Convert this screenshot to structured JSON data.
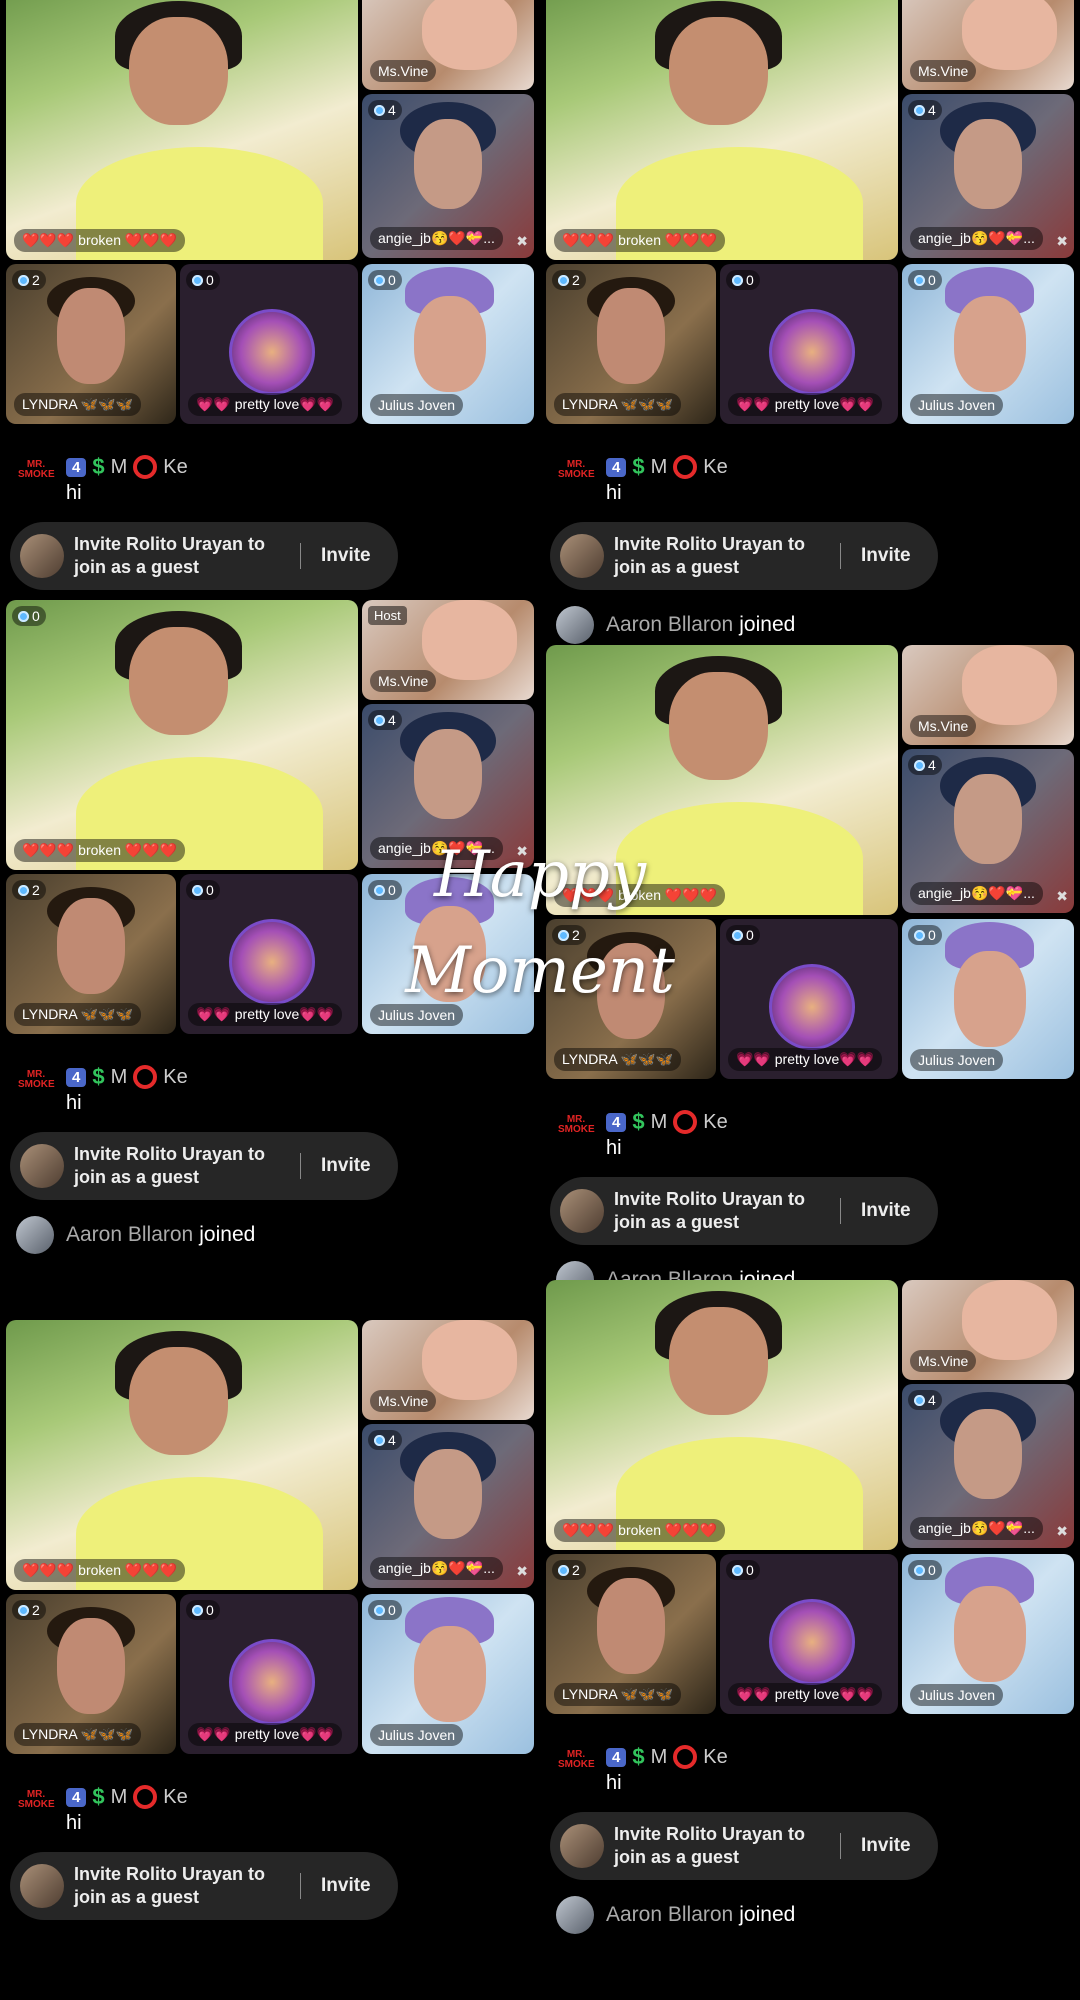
{
  "stream": {
    "host_tag": "Host",
    "tiles": {
      "main": {
        "label": "❤️❤️❤️ broken ❤️❤️❤️"
      },
      "vine": {
        "label": "Ms.Vine"
      },
      "angie": {
        "label": "angie_jb😚❤️💝...",
        "count": "4"
      },
      "lyndra": {
        "label": "LYNDRA 🦋🦋🦋",
        "count": "2"
      },
      "pretty": {
        "label": "💗💗 pretty love💗💗",
        "count": "0"
      },
      "julius": {
        "label": "Julius Joven",
        "count": "0"
      },
      "main_count": "0"
    },
    "comment": {
      "badge_text": "MR. SMOKE",
      "level": "4",
      "dollar": "$",
      "name_prefix": "M",
      "name_suffix": "Ke",
      "text": "hi"
    },
    "invite": {
      "text": "Invite Rolito Urayan to join as a guest",
      "button": "Invite"
    },
    "joined": {
      "name": "Aaron Bllaron",
      "action": "joined"
    }
  },
  "overlay": {
    "line1": "Happy",
    "line2": "Moment"
  },
  "icons": {
    "mute": "mute-icon",
    "viewer": "viewer-dot-icon"
  }
}
